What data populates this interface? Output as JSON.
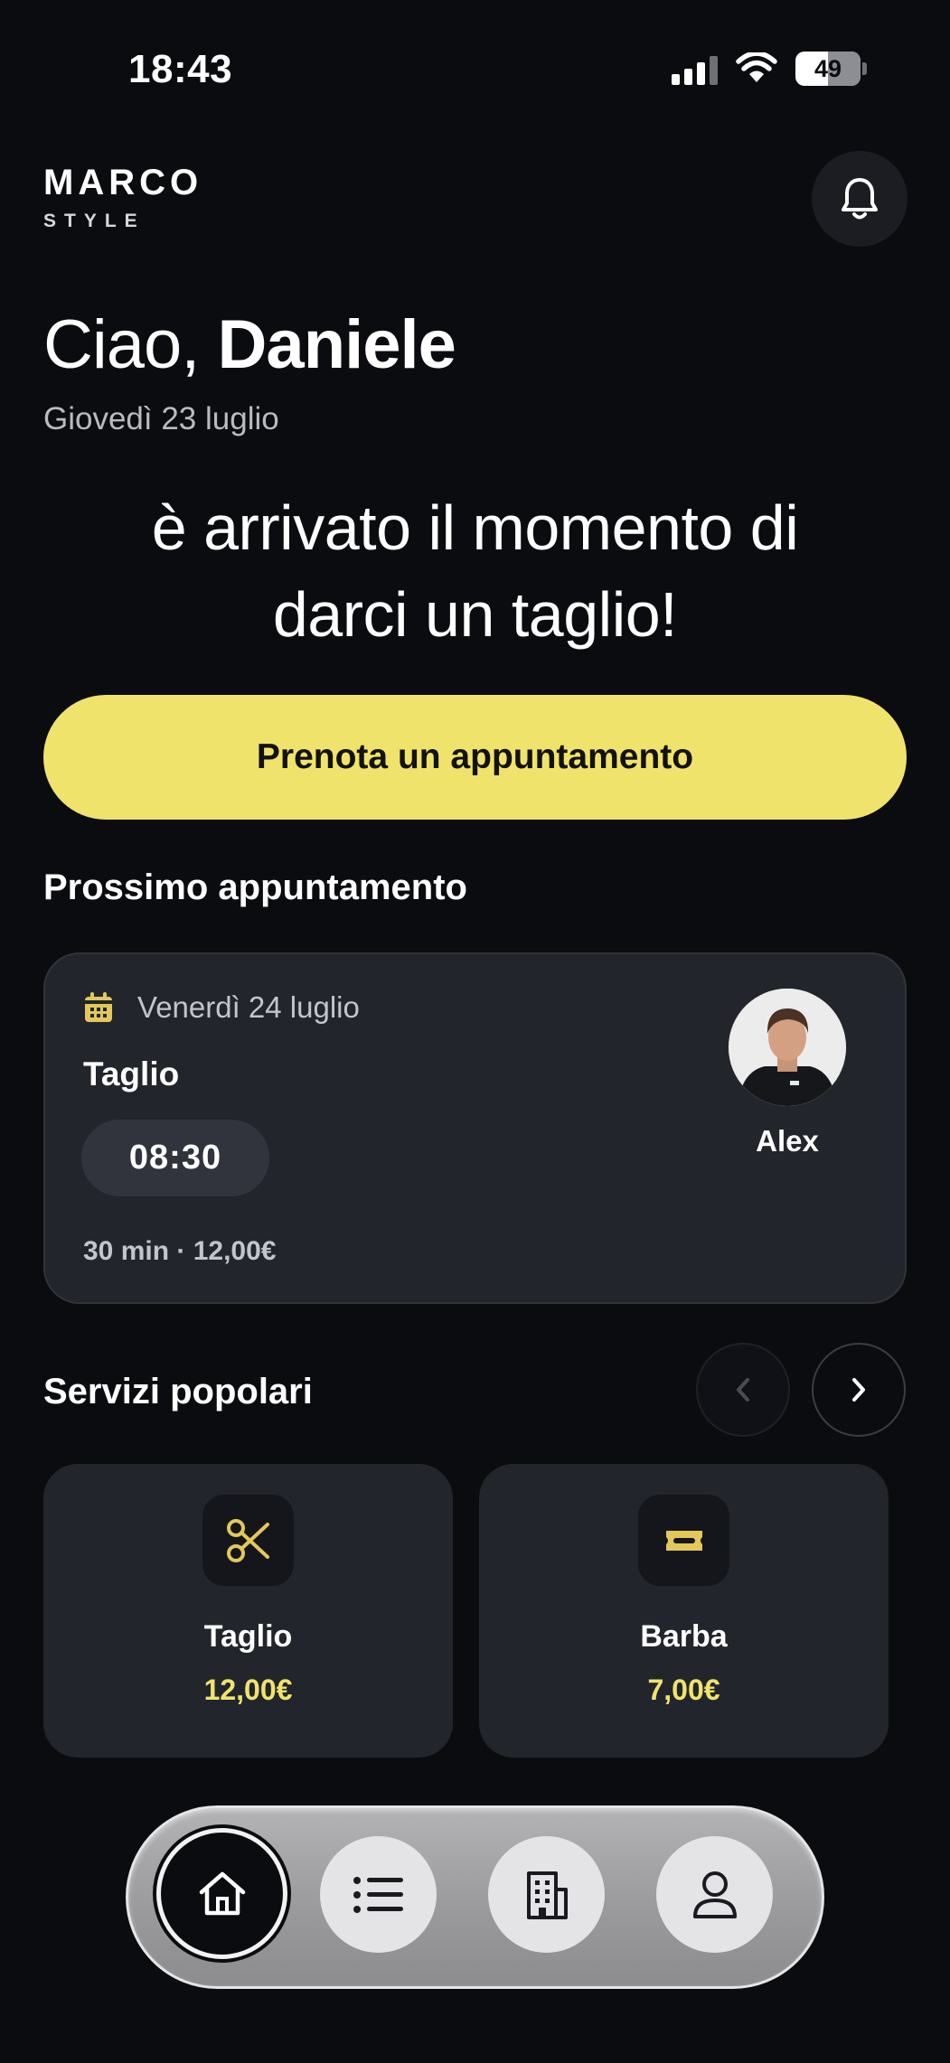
{
  "status_bar": {
    "time": "18:43",
    "battery": "49"
  },
  "header": {
    "brand": "MARCO",
    "brand_sub": "STYLE"
  },
  "greeting": {
    "hello": "Ciao,",
    "name": "Daniele",
    "date": "Giovedì 23 luglio"
  },
  "tagline": {
    "line1": "è arrivato il momento di",
    "line2": "darci un taglio!"
  },
  "cta": {
    "label": "Prenota un appuntamento"
  },
  "next_appointment": {
    "section_title": "Prossimo appuntamento",
    "date": "Venerdì 24 luglio",
    "service": "Taglio",
    "time": "08:30",
    "meta": "30 min · 12,00€",
    "barber": "Alex"
  },
  "popular": {
    "section_title": "Servizi popolari",
    "services": [
      {
        "name": "Taglio",
        "price": "12,00€",
        "icon": "scissors-icon"
      },
      {
        "name": "Barba",
        "price": "7,00€",
        "icon": "razor-icon"
      }
    ]
  },
  "tabbar": {
    "items": [
      {
        "icon": "home-icon",
        "active": true
      },
      {
        "icon": "list-icon",
        "active": false
      },
      {
        "icon": "building-icon",
        "active": false
      },
      {
        "icon": "profile-icon",
        "active": false
      }
    ]
  },
  "colors": {
    "background": "#0b0c10",
    "card": "#22252c",
    "accent": "#f0e36c"
  }
}
